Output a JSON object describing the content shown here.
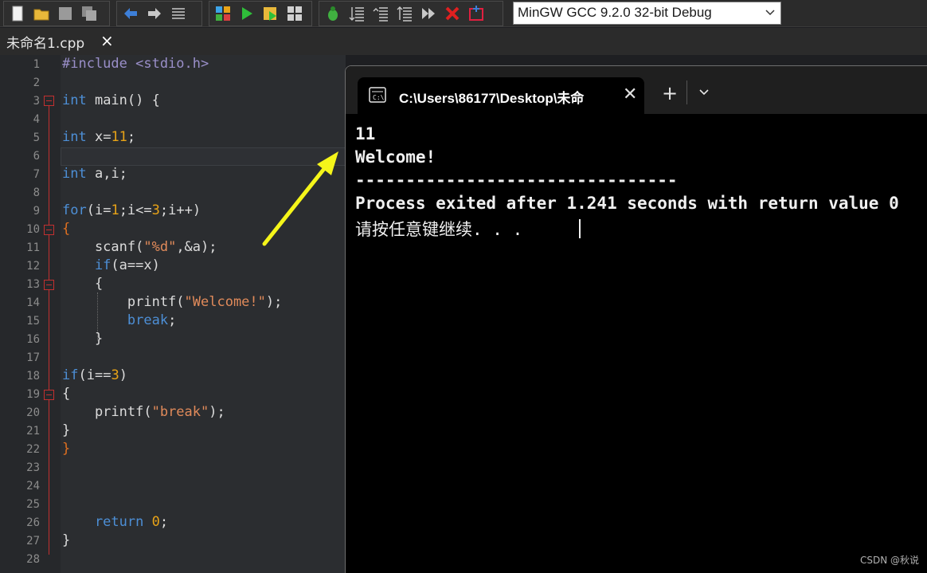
{
  "toolbar": {
    "compiler_selected": "MinGW GCC 9.2.0 32-bit Debug"
  },
  "file_tab": {
    "name": "未命名1.cpp",
    "close": "×"
  },
  "editor": {
    "line_numbers": [
      "1",
      "2",
      "3",
      "4",
      "5",
      "6",
      "7",
      "8",
      "9",
      "10",
      "11",
      "12",
      "13",
      "14",
      "15",
      "16",
      "17",
      "18",
      "19",
      "20",
      "21",
      "22",
      "23",
      "24",
      "25",
      "26",
      "27",
      "28"
    ],
    "lines": {
      "l1_pp": "#include <stdio.h>",
      "l3_kw": "int",
      "l3_rest": " main() {",
      "l5_kw": "int",
      "l5_mid": " x=",
      "l5_num": "11",
      "l5_end": ";",
      "l7_kw": "int",
      "l7_rest": " a,i;",
      "l9_kw": "for",
      "l9_a": "(i=",
      "l9_n1": "1",
      "l9_b": ";i<=",
      "l9_n2": "3",
      "l9_c": ";i++)",
      "l10_br": "{",
      "l11_a": "    scanf(",
      "l11_str": "\"%d\"",
      "l11_b": ",&a);",
      "l12_kw": "    if",
      "l12_rest": "(a==x)",
      "l13_br": "    {",
      "l14_a": "        printf(",
      "l14_str": "\"Welcome!\"",
      "l14_b": ");",
      "l15_kw": "        break",
      "l15_rest": ";",
      "l16_br": "    }",
      "l18_kw": "if",
      "l18_a": "(i==",
      "l18_num": "3",
      "l18_b": ")",
      "l19_br": "{",
      "l20_a": "    printf(",
      "l20_str": "\"break\"",
      "l20_b": ");",
      "l21_br": "}",
      "l22_br": "}",
      "l26_kw": "    return",
      "l26_sp": " ",
      "l26_num": "0",
      "l26_end": ";",
      "l27_br": "}"
    }
  },
  "terminal": {
    "tab_title": "C:\\Users\\86177\\Desktop\\未命",
    "tab_close": "✕",
    "new_tab": "+",
    "output": [
      "11",
      "Welcome!",
      "--------------------------------",
      "Process exited after 1.241 seconds with return value 0",
      "请按任意键继续. . ."
    ]
  },
  "watermark": "CSDN @秋说",
  "colors": {
    "keyword": "#4d8fd6",
    "number": "#e8a317",
    "string": "#e08a5a",
    "arrow": "#f5f51a"
  }
}
